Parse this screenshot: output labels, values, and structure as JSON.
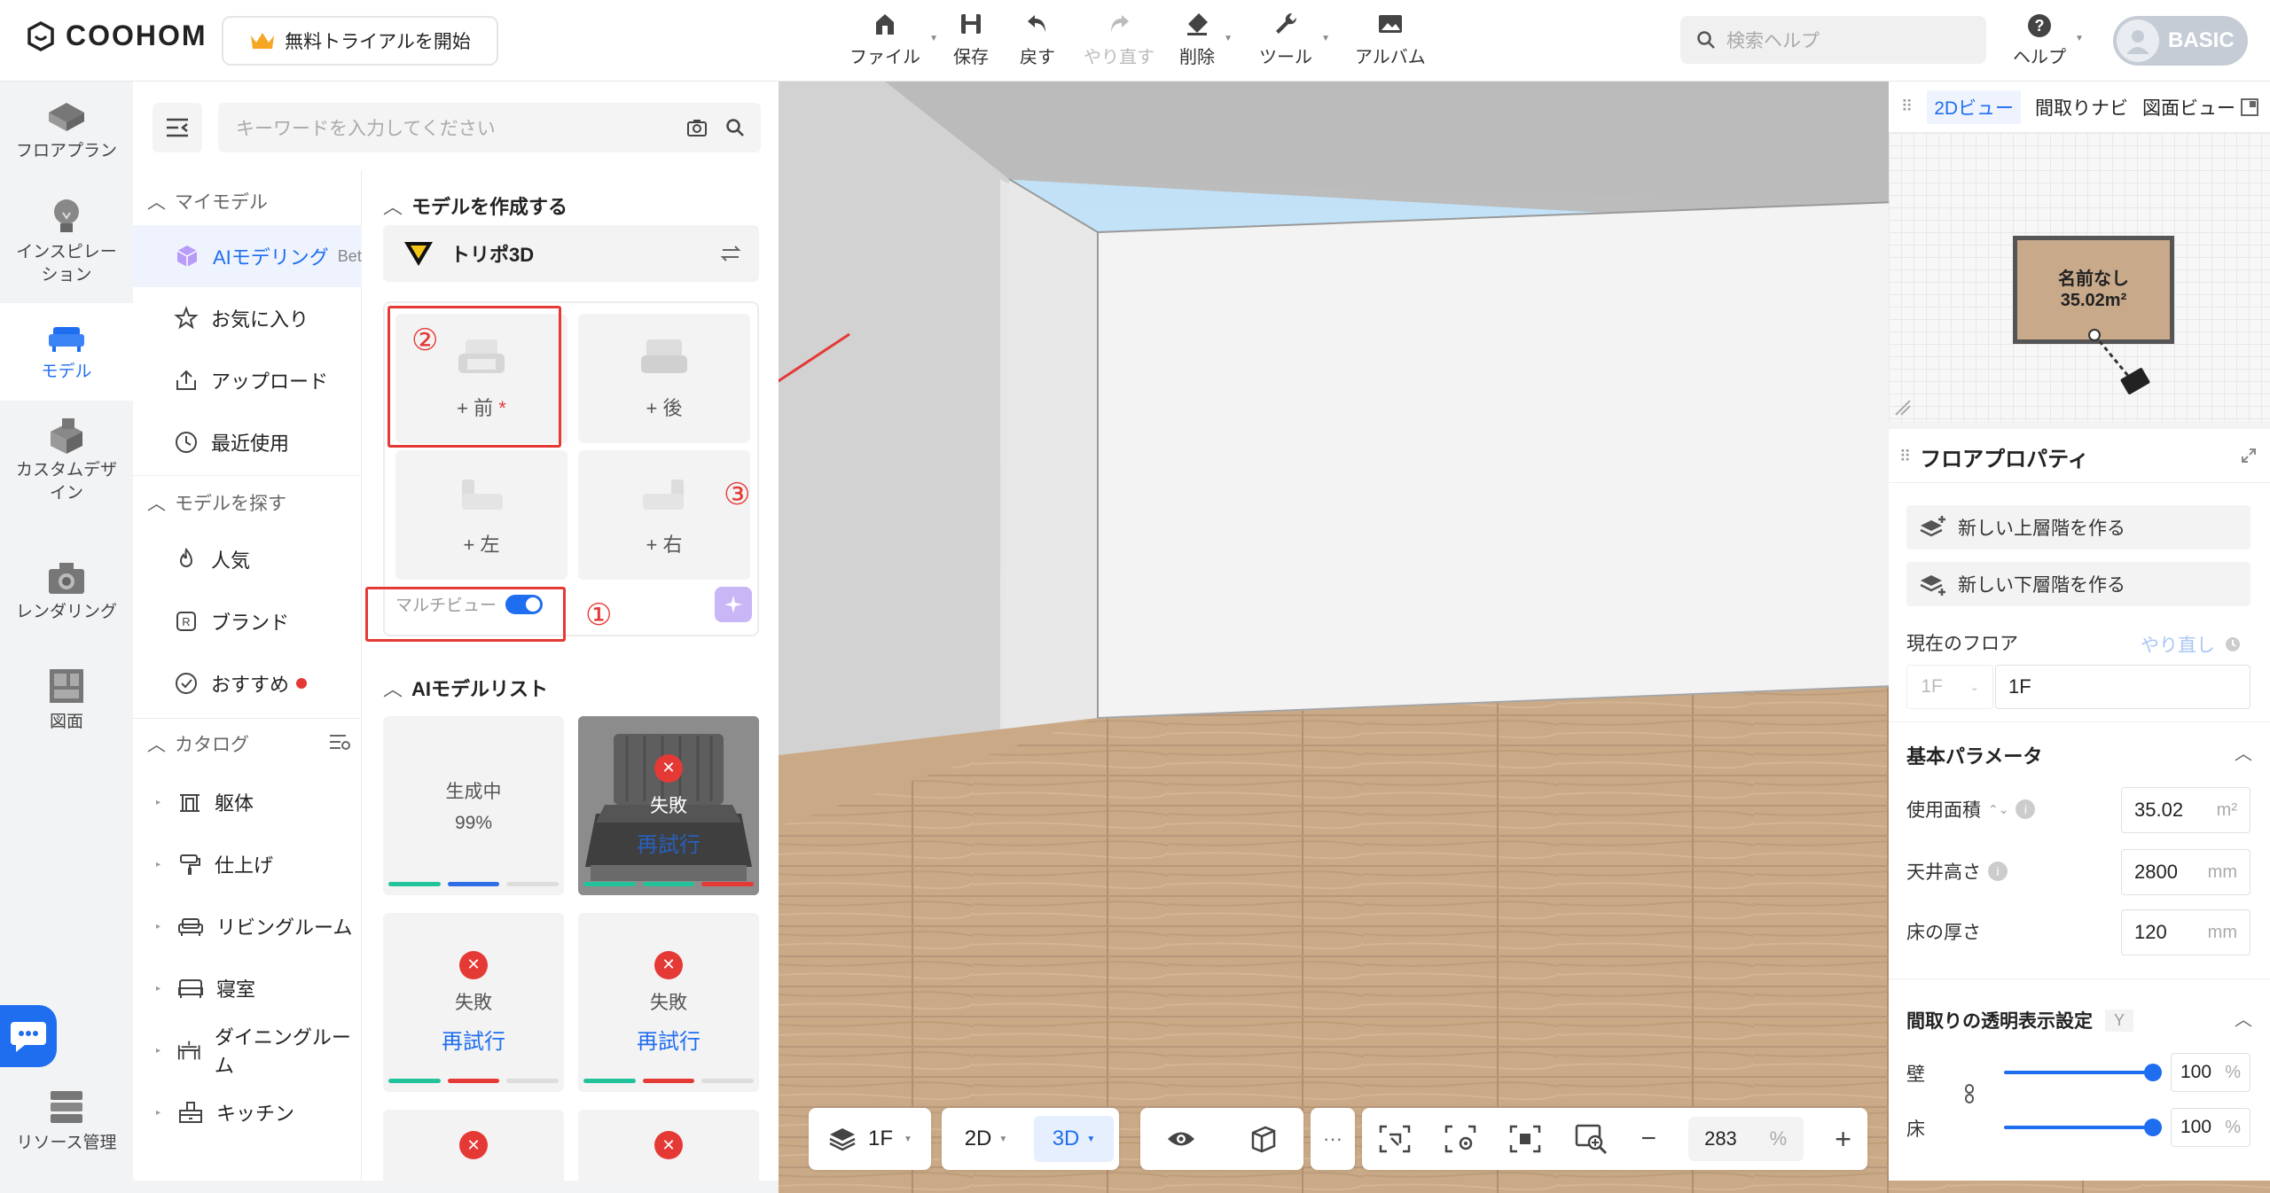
{
  "app": {
    "logo": "COOHOM",
    "trial_label": "無料トライアルを開始"
  },
  "toolbar": {
    "file": "ファイル",
    "save": "保存",
    "undo": "戻す",
    "redo": "やり直す",
    "delete": "削除",
    "tools": "ツール",
    "album": "アルバム"
  },
  "search": {
    "placeholder": "検索ヘルプ"
  },
  "help": {
    "label": "ヘルプ"
  },
  "account": {
    "plan": "BASIC"
  },
  "leftbar": [
    {
      "label": "フロアプラン"
    },
    {
      "label": "インスピレーション"
    },
    {
      "label": "モデル"
    },
    {
      "label": "カスタムデザイン"
    },
    {
      "label": "レンダリング"
    },
    {
      "label": "図面"
    },
    {
      "label": "リソース管理"
    }
  ],
  "panel": {
    "search_placeholder": "キーワードを入力してください",
    "my_models": "マイモデル",
    "ai_modeling": "AIモデリング",
    "ai_badge": "Bet",
    "favorites": "お気に入り",
    "upload": "アップロード",
    "recent": "最近使用",
    "find_models": "モデルを探す",
    "popular": "人気",
    "brand": "ブランド",
    "recommended": "おすすめ",
    "catalog": "カタログ",
    "catalog_items": [
      "躯体",
      "仕上げ",
      "リビングルーム",
      "寝室",
      "ダイニングルーム",
      "キッチン"
    ]
  },
  "create": {
    "title": "モデルを作成する",
    "engine": "トリポ3D",
    "views": {
      "front": "+ 前",
      "required": "*",
      "back": "+ 後",
      "left": "+ 左",
      "right": "+ 右"
    },
    "multiview_label": "マルチビュー",
    "annotations": [
      "①",
      "②",
      "③"
    ]
  },
  "ai_list": {
    "title": "AIモデルリスト",
    "generating": "生成中",
    "progress": "99%",
    "failed": "失敗",
    "retry": "再試行"
  },
  "right": {
    "tabs": [
      "2Dビュー",
      "間取りナビ",
      "図面ビュー"
    ],
    "room_name": "名前なし",
    "room_area": "35.02m²",
    "floor_props": "フロアプロパティ",
    "new_upper": "新しい上層階を作る",
    "new_lower": "新しい下層階を作る",
    "current_floor": "現在のフロア",
    "redo": "やり直し",
    "floor_code": "1F",
    "floor_value": "1F",
    "basic_params": "基本パラメータ",
    "area_label": "使用面積",
    "area_value": "35.02",
    "area_unit": "m²",
    "ceiling_label": "天井高さ",
    "ceiling_value": "2800",
    "ceiling_unit": "mm",
    "floor_thk_label": "床の厚さ",
    "floor_thk_value": "120",
    "floor_thk_unit": "mm",
    "transparency": "間取りの透明表示設定",
    "transparency_key": "Y",
    "wall": "壁",
    "wall_value": "100",
    "floor": "床",
    "floor_opacity": "100",
    "pct": "%"
  },
  "bottom": {
    "floor": "1F",
    "mode2d": "2D",
    "mode3d": "3D",
    "more": "···",
    "zoom": "283",
    "zoom_unit": "%"
  }
}
